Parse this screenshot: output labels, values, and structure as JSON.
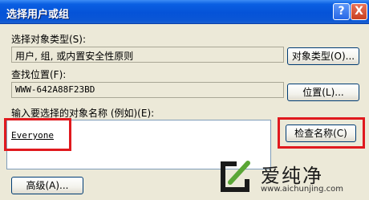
{
  "window": {
    "title": "选择用户或组",
    "help_label": "?",
    "close_label": "X"
  },
  "object_types": {
    "label": "选择对象类型(S):",
    "value": "用户, 组, 或内置安全性原则",
    "button": "对象类型(O)..."
  },
  "location": {
    "label": "查找位置(F):",
    "value": "WWW-642A88F23BD",
    "button": "位置(L)..."
  },
  "names": {
    "label": "输入要选择的对象名称 (例如)(E):",
    "value": "Everyone",
    "check_button": "检查名称(C)"
  },
  "advanced_button": "高级(A)...",
  "watermark": {
    "text": "爱纯净",
    "url": "www.aichunjing.com"
  },
  "colors": {
    "highlight": "#e0191e",
    "titlebar": "#0553d8"
  }
}
